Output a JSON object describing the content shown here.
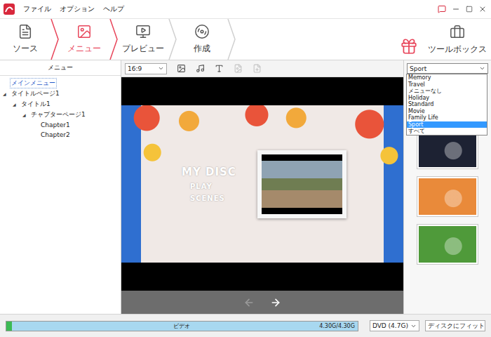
{
  "window": {
    "menu": [
      "ファイル",
      "オプション",
      "ヘルプ"
    ]
  },
  "steps": [
    {
      "label": "ソース",
      "selected": false
    },
    {
      "label": "メニュー",
      "selected": true
    },
    {
      "label": "プレビュー",
      "selected": false
    },
    {
      "label": "作成",
      "selected": false
    }
  ],
  "toolbox": {
    "label": "ツールボックス"
  },
  "tree": {
    "header": "メニュー",
    "items": [
      {
        "label": "メインメニュー",
        "selected": true,
        "children": []
      },
      {
        "label": "タイトルページ1",
        "selected": false,
        "expander": "◢",
        "expanded": true,
        "children": [
          {
            "label": "タイトル1",
            "selected": false,
            "expander": "◢",
            "expanded": true,
            "children": [
              {
                "label": "チャプターページ1",
                "selected": false,
                "expander": "◢",
                "expanded": true,
                "children": [
                  {
                    "label": "Chapter1",
                    "selected": false,
                    "children": []
                  },
                  {
                    "label": "Chapter2",
                    "selected": false,
                    "children": []
                  }
                ]
              }
            ]
          }
        ]
      }
    ]
  },
  "toolbar": {
    "aspect": "16:9",
    "tools": [
      {
        "disabled": false
      },
      {
        "disabled": false
      },
      {
        "disabled": false
      },
      {
        "disabled": true
      },
      {
        "disabled": true
      }
    ]
  },
  "preview": {
    "title": "MY DISC",
    "buttons": [
      "PLAY",
      "SCENES"
    ],
    "prev": {
      "disabled": true
    },
    "next": {
      "disabled": false
    }
  },
  "templates": {
    "value": "Sport",
    "open": true,
    "options": [
      {
        "label": "Memory",
        "selected": false
      },
      {
        "label": "Travel",
        "selected": false
      },
      {
        "label": "メニューなし",
        "selected": false
      },
      {
        "label": "Holiday",
        "selected": false
      },
      {
        "label": "Standard",
        "selected": false
      },
      {
        "label": "Movie",
        "selected": false
      },
      {
        "label": "Family Life",
        "selected": false
      },
      {
        "label": "Sport",
        "selected": true
      },
      {
        "label": "すべて",
        "selected": false
      }
    ],
    "thumbnails": [
      {
        "color": "#2a4d7a"
      },
      {
        "color": "#1d2233"
      },
      {
        "color": "#e98a3a"
      },
      {
        "color": "#4f9a3a"
      }
    ]
  },
  "usage": {
    "label": "ビデオ",
    "reading": "4.30G/4.30G",
    "segments": [
      {
        "color": "#3cba54",
        "level": 0.015
      },
      {
        "color": "#a8d8f0",
        "level": 0.985
      }
    ]
  },
  "disc": {
    "value": "DVD (4.7G)"
  },
  "fit": {
    "value": "ディスクにフィット"
  }
}
